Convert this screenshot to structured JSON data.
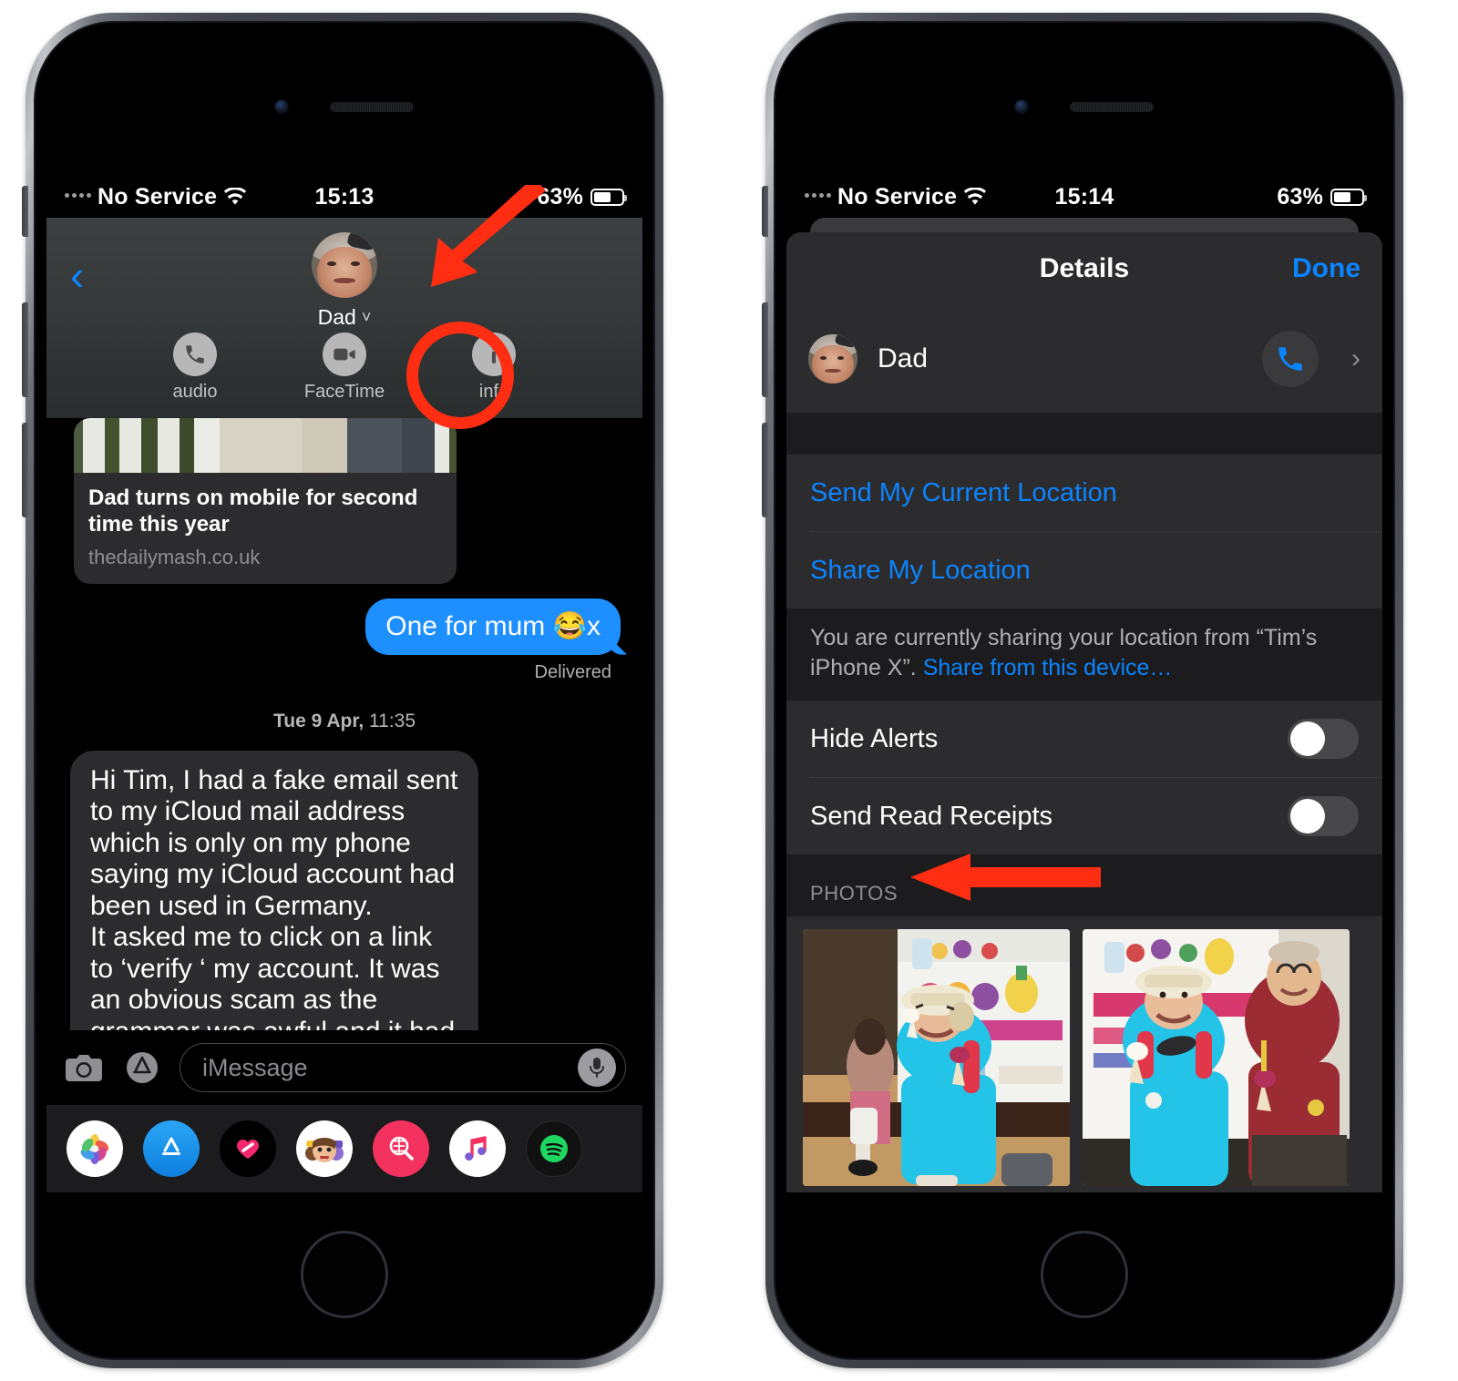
{
  "left_phone": {
    "status_bar": {
      "carrier": "No Service",
      "time": "15:13",
      "battery_pct": "63%",
      "wifi_icon": "wifi-icon",
      "battery_icon": "battery-icon"
    },
    "header": {
      "back_icon": "back-chevron-icon",
      "contact_name": "Dad",
      "expand_icon": "chevron-down-icon",
      "actions": [
        {
          "label": "audio",
          "icon": "phone-icon"
        },
        {
          "label": "FaceTime",
          "icon": "video-camera-icon"
        },
        {
          "label": "info",
          "icon": "info-icon"
        }
      ]
    },
    "conversation": {
      "link_preview": {
        "title": "Dad turns on mobile for second time this year",
        "url": "thedailymash.co.uk"
      },
      "outgoing_message": "One for mum 😂x",
      "delivery_status": "Delivered",
      "timestamp_day": "Tue 9 Apr,",
      "timestamp_time": "11:35",
      "incoming_message": "Hi Tim, I had a fake email sent to my iCloud mail address which is only on my phone saying my iCloud account had been used in Germany.\nIt asked me to click on a link to ‘verify ‘ my account. It was an obvious scam as the grammar was awful and it had a dubious Apple logo. Just thought you should know. Dad x"
    },
    "input_bar": {
      "camera_icon": "camera-icon",
      "appstore_icon": "app-store-icon",
      "placeholder": "iMessage",
      "mic_icon": "microphone-icon"
    },
    "dock": [
      {
        "name": "photos-app-icon"
      },
      {
        "name": "app-store-app-icon"
      },
      {
        "name": "digital-touch-app-icon"
      },
      {
        "name": "memoji-app-icon"
      },
      {
        "name": "images-search-app-icon"
      },
      {
        "name": "apple-music-app-icon"
      },
      {
        "name": "spotify-app-icon"
      }
    ],
    "annotations": {
      "arrow": "red-arrow-pointing-to-info",
      "circle": "red-circle-around-info-button"
    }
  },
  "right_phone": {
    "status_bar": {
      "carrier": "No Service",
      "time": "15:14",
      "battery_pct": "63%",
      "wifi_icon": "wifi-icon",
      "battery_icon": "battery-icon"
    },
    "sheet": {
      "title": "Details",
      "done_label": "Done",
      "contact": {
        "name": "Dad",
        "call_icon": "phone-icon",
        "disclosure_icon": "chevron-right-icon"
      },
      "location_actions": [
        {
          "label": "Send My Current Location"
        },
        {
          "label": "Share My Location"
        }
      ],
      "location_note_prefix": "You are currently sharing your location from “Tim’s iPhone X”. ",
      "location_note_link": "Share from this device…",
      "toggles": [
        {
          "label": "Hide Alerts",
          "state": "off"
        },
        {
          "label": "Send Read Receipts",
          "state": "off"
        }
      ],
      "photos_header": "PHOTOS",
      "photos": [
        {
          "name": "photo-woman-ice-cream"
        },
        {
          "name": "photo-couple-ice-cream"
        },
        {
          "name": "photo-partial-pink"
        },
        {
          "name": "photo-partial-green"
        }
      ]
    },
    "annotations": {
      "arrow": "red-arrow-pointing-to-photos"
    }
  },
  "colors": {
    "accent_blue": "#0a84ff",
    "bubble_blue": "#1e8fff",
    "bubble_gray": "#2c2c2e",
    "annotation_red": "#ff2d11",
    "sheet_bg": "#1c1c1e"
  }
}
